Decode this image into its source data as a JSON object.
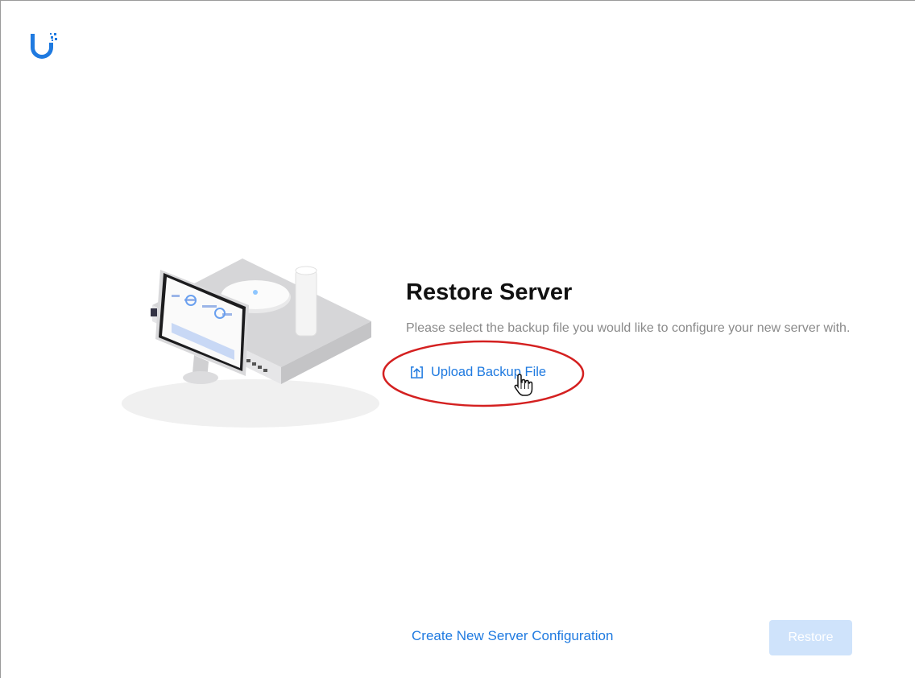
{
  "brand": {
    "logo_icon": "ubiquiti-u-logo-icon",
    "accent_color": "#1f7ae0"
  },
  "main": {
    "title": "Restore Server",
    "subtitle": "Please select the backup file you would like to configure your new server with.",
    "upload": {
      "icon": "upload-icon",
      "label": "Upload Backup File"
    }
  },
  "footer": {
    "create_link": "Create New Server Configuration",
    "restore_button": "Restore",
    "restore_disabled": true
  },
  "annotation": {
    "highlight_color": "#d42020"
  }
}
